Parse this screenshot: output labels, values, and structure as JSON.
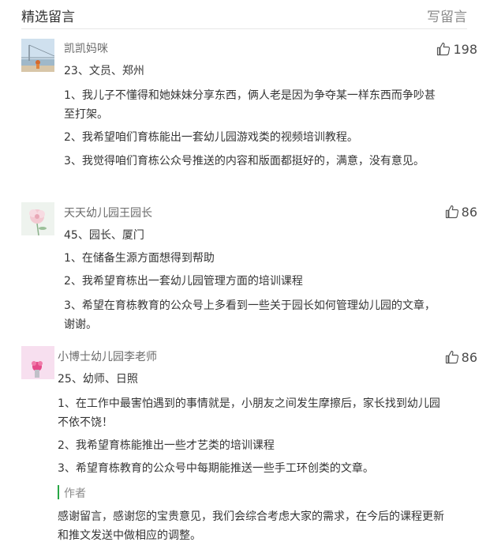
{
  "header": {
    "title": "精选留言",
    "write_label": "写留言"
  },
  "comments": [
    {
      "nickname": "凯凯妈咪",
      "likes": "198",
      "lines": [
        "23、文员、郑州",
        "1、我儿子不懂得和她妹妹分享东西，俩人老是因为争夺某一样东西而争吵甚至打架。",
        "2、我希望咱们育栋能出一套幼儿园游戏类的视频培训教程。",
        "3、我觉得咱们育栋公众号推送的内容和版面都挺好的，满意，没有意见。"
      ]
    },
    {
      "nickname": "天天幼儿园王园长",
      "likes": "86",
      "lines": [
        "45、园长、厦门",
        "1、在储备生源方面想得到帮助",
        "2、我希望育栋出一套幼儿园管理方面的培训课程",
        "3、希望在育栋教育的公众号上多看到一些关于园长如何管理幼儿园的文章，谢谢。"
      ]
    },
    {
      "nickname": "小博士幼儿园李老师",
      "likes": "86",
      "lines": [
        "25、幼师、日照",
        "1、在工作中最害怕遇到的事情就是，小朋友之间发生摩擦后，家长找到幼儿园不依不饶！",
        "2、我希望育栋能推出一些才艺类的培训课程",
        "3、希望育栋教育的公众号中每期能推送一些手工环创类的文章。"
      ],
      "reply": {
        "label": "作者",
        "text": "感谢留言，感谢您的宝贵意见，我们会综合考虑大家的需求，在今后的课程更新和推文发送中做相应的调整。"
      }
    }
  ],
  "colors": {
    "accent_green": "#28a745"
  },
  "icons": {
    "like": "thumbs-up-icon"
  }
}
